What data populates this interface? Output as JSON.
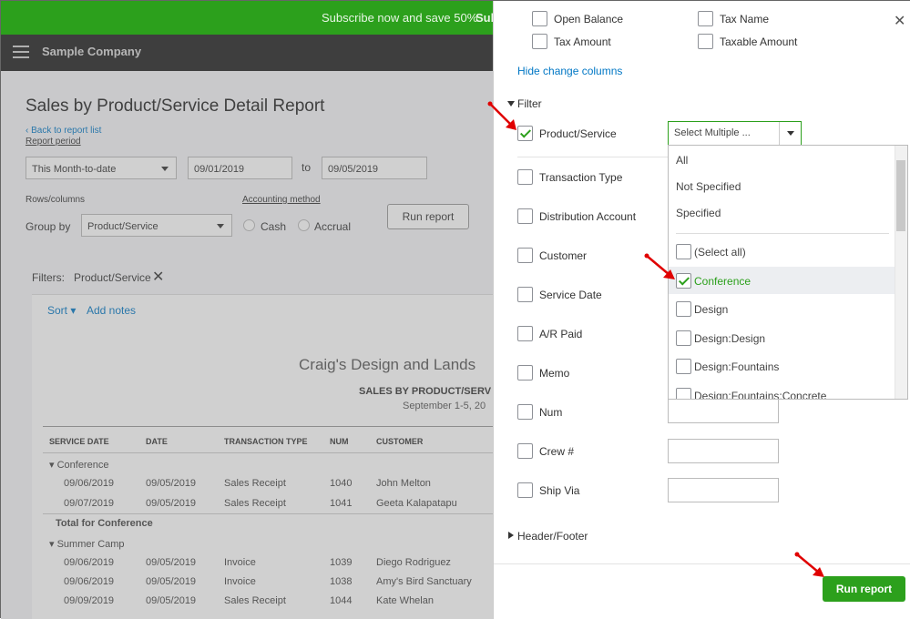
{
  "promo": {
    "text": "Subscribe now and save 50%",
    "sub": "Sub"
  },
  "topbar": {
    "company": "Sample Company"
  },
  "report": {
    "title": "Sales by Product/Service Detail Report",
    "back": "Back to report list",
    "period_label": "Report period",
    "period_value": "This Month-to-date",
    "from": "09/01/2019",
    "to_label": "to",
    "to": "09/05/2019",
    "rows_columns": "Rows/columns",
    "group_by_label": "Group by",
    "group_by_value": "Product/Service",
    "accounting_method": "Accounting method",
    "cash": "Cash",
    "accrual": "Accrual",
    "run_report": "Run report",
    "filters_label": "Filters:",
    "filter_chip": "Product/Service",
    "sort": "Sort",
    "add_notes": "Add notes",
    "company_name": "Craig's Design and Lands",
    "report_heading": "SALES BY PRODUCT/SERV",
    "date_range": "September 1-5, 20",
    "columns": [
      "SERVICE DATE",
      "DATE",
      "TRANSACTION TYPE",
      "NUM",
      "CUSTOMER"
    ],
    "group1": "Conference",
    "group1_rows": [
      [
        "09/06/2019",
        "09/05/2019",
        "Sales Receipt",
        "1040",
        "John Melton"
      ],
      [
        "09/07/2019",
        "09/05/2019",
        "Sales Receipt",
        "1041",
        "Geeta Kalapatapu"
      ]
    ],
    "group1_total": "Total for Conference",
    "group2": "Summer Camp",
    "group2_rows": [
      [
        "09/06/2019",
        "09/05/2019",
        "Invoice",
        "1039",
        "Diego Rodriguez"
      ],
      [
        "09/06/2019",
        "09/05/2019",
        "Invoice",
        "1038",
        "Amy's Bird Sanctuary"
      ],
      [
        "09/09/2019",
        "09/05/2019",
        "Sales Receipt",
        "1044",
        "Kate Whelan"
      ]
    ]
  },
  "panel": {
    "columns": {
      "open_balance": "Open Balance",
      "tax_name": "Tax Name",
      "tax_amount": "Tax Amount",
      "taxable_amount": "Taxable Amount"
    },
    "hide_change": "Hide change columns",
    "filter": "Filter",
    "filters": [
      {
        "label": "Product/Service",
        "checked": true
      },
      {
        "label": "Transaction Type",
        "checked": false
      },
      {
        "label": "Distribution Account",
        "checked": false
      },
      {
        "label": "Customer",
        "checked": false
      },
      {
        "label": "Service Date",
        "checked": false
      },
      {
        "label": "A/R Paid",
        "checked": false
      },
      {
        "label": "Memo",
        "checked": false
      },
      {
        "label": "Num",
        "checked": false
      },
      {
        "label": "Crew #",
        "checked": false
      },
      {
        "label": "Ship Via",
        "checked": false
      }
    ],
    "select_placeholder": "Select Multiple ...",
    "dropdown_options": [
      "All",
      "Not Specified",
      "Specified"
    ],
    "dropdown_checks": [
      {
        "label": "(Select all)",
        "checked": false
      },
      {
        "label": "Conference",
        "checked": true
      },
      {
        "label": "Design",
        "checked": false
      },
      {
        "label": "Design:Design",
        "checked": false
      },
      {
        "label": "Design:Fountains",
        "checked": false
      },
      {
        "label": "Design:Fountains:Concrete",
        "checked": false
      }
    ],
    "header_footer": "Header/Footer",
    "run_report": "Run report"
  },
  "colors": {
    "green": "#2ca01c",
    "link": "#0077c5",
    "annotation_red": "#e00000"
  }
}
